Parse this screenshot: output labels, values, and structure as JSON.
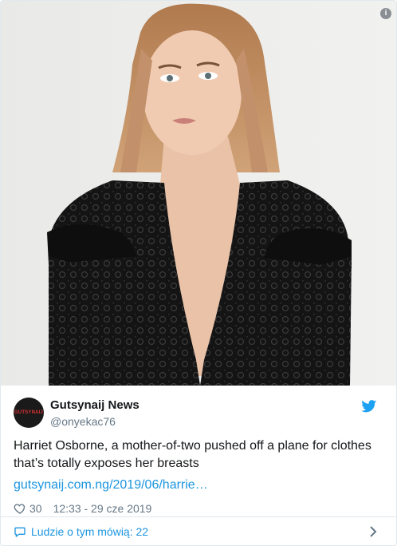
{
  "media": {
    "alt_hidden": "",
    "info_glyph": "i"
  },
  "tweet": {
    "avatar_text": "GUTSYNAIJ",
    "display_name": "Gutsynaij News",
    "handle": "@onyekac76",
    "text": "Harriet Osborne, a mother-of-two pushed off a plane for clothes that’s totally exposes her breasts",
    "link": "gutsynaij.com.ng/2019/06/harrie…",
    "likes": "30",
    "timestamp": "12:33 - 29 cze 2019"
  },
  "footer": {
    "label": "Ludzie o tym mówią: 22"
  },
  "colors": {
    "twitter_blue": "#1b95e0",
    "muted": "#657786",
    "text": "#14171a"
  }
}
